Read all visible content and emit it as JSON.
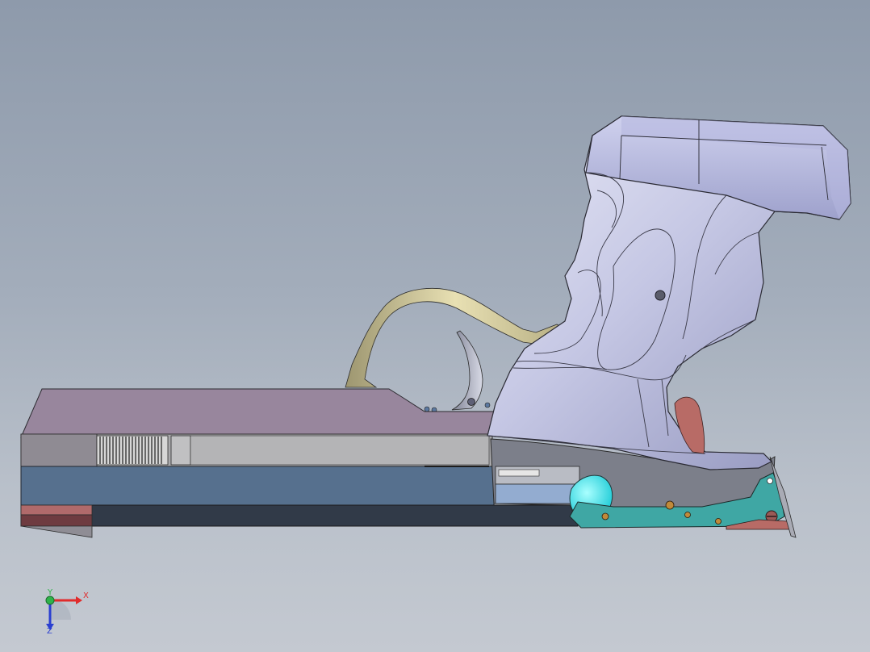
{
  "app": {
    "view_type": "3D CAD section view",
    "colors": {
      "background_top": "#8e9aab",
      "background_bottom": "#c4c9d1",
      "frame_mauve": "#98869d",
      "barrel_blue": "#56708e",
      "grip_lavender": "#c6c8e6",
      "trigger_guard_tan": "#cfc79a",
      "mechanism_teal": "#3fa7a4",
      "insert_red": "#b86b66"
    }
  },
  "triad": {
    "x_label": "X",
    "y_label": "Y",
    "z_label": "Z",
    "x_color": "#e12b2b",
    "y_color": "#2fb34a",
    "z_color": "#2a3fd1"
  }
}
